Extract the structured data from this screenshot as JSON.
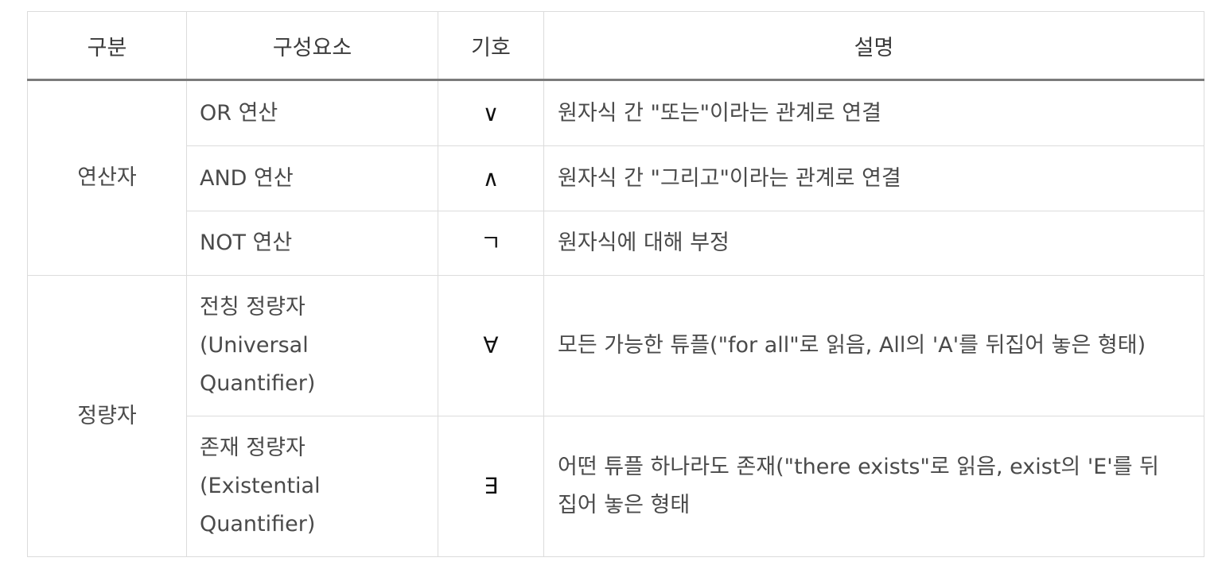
{
  "header": {
    "col1": "구분",
    "col2": "구성요소",
    "col3": "기호",
    "col4": "설명"
  },
  "groups": [
    {
      "category": "연산자",
      "rows": [
        {
          "component": "OR 연산",
          "symbol": "∨",
          "description": "원자식 간 \"또는\"이라는 관계로 연결"
        },
        {
          "component": "AND 연산",
          "symbol": "∧",
          "description": "원자식 간 \"그리고\"이라는 관계로 연결"
        },
        {
          "component": "NOT 연산",
          "symbol": "ㄱ",
          "description": "원자식에 대해 부정"
        }
      ]
    },
    {
      "category": "정량자",
      "rows": [
        {
          "component_lines": [
            "전칭 정량자",
            "(Universal",
            "Quantifier)"
          ],
          "symbol": "∀",
          "description": "모든 가능한 튜플(\"for all\"로 읽음, All의 'A'를 뒤집어 놓은 형태)"
        },
        {
          "component_lines": [
            "존재 정량자",
            "(Existential",
            "Quantifier)"
          ],
          "symbol": "∃",
          "description_lines": [
            "어떤 튜플 하나라도 존재(\"there exists\"로 읽음, exist의 'E'를 뒤",
            "집어 놓은 형태"
          ]
        }
      ]
    }
  ]
}
